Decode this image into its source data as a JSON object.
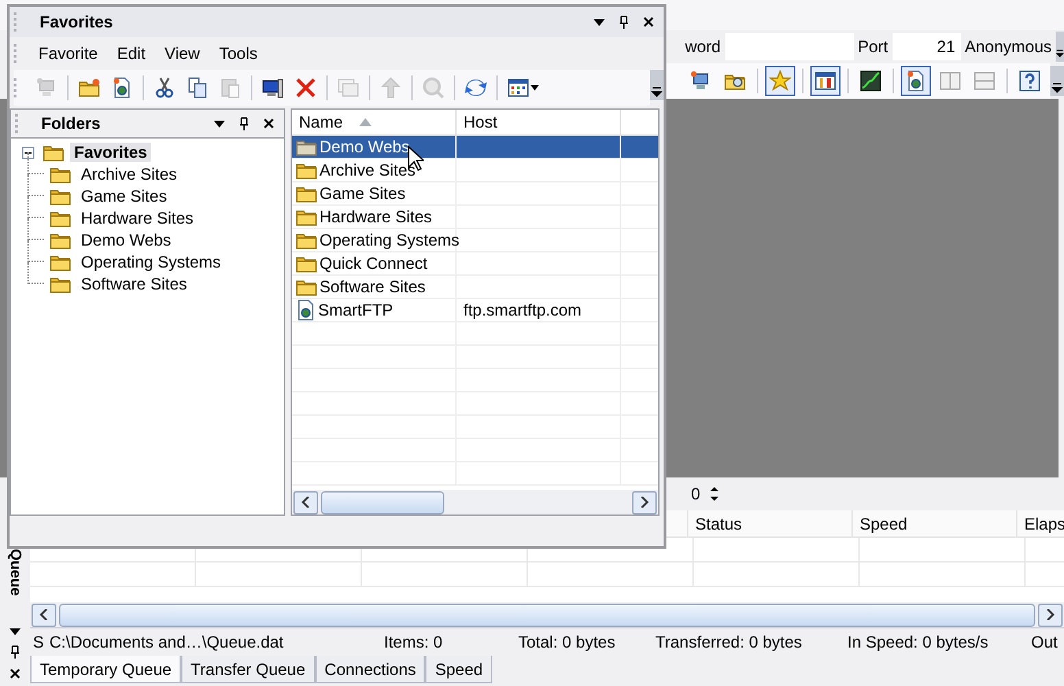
{
  "main": {
    "connect_bar": {
      "password_label": "word",
      "port_label": "Port",
      "port": "21",
      "anonymous_label": "Anonymous"
    },
    "toolbar": [
      [
        {
          "kind": "computer",
          "pressed": false
        },
        {
          "kind": "folder-search",
          "pressed": false
        }
      ],
      [
        {
          "kind": "star",
          "pressed": true
        }
      ],
      [
        {
          "kind": "tools",
          "pressed": true
        }
      ],
      [
        {
          "kind": "graph",
          "pressed": false
        }
      ],
      [
        {
          "kind": "page",
          "pressed": true
        },
        {
          "kind": "split-v",
          "pressed": false
        },
        {
          "kind": "split-h",
          "pressed": false
        }
      ],
      [
        {
          "kind": "help",
          "pressed": false
        }
      ]
    ],
    "spin_value": "0",
    "queue": {
      "side_label": "Queue",
      "columns": [
        "Status",
        "Speed",
        "Elaps"
      ],
      "status_bar": [
        "S",
        "C:\\Documents and…\\Queue.dat",
        "Items: 0",
        "Total: 0 bytes",
        "Transferred: 0 bytes",
        "In Speed: 0 bytes/s",
        "Out"
      ],
      "tabs": [
        {
          "label": "Temporary Queue",
          "selected": true
        },
        {
          "label": "Transfer Queue",
          "selected": false
        },
        {
          "label": "Connections",
          "selected": false
        },
        {
          "label": "Speed",
          "selected": false
        }
      ]
    }
  },
  "favorites_window": {
    "title": "Favorites",
    "menu": [
      "Favorite",
      "Edit",
      "View",
      "Tools"
    ],
    "toolbar": [
      [
        {
          "kind": "computer",
          "disabled": true
        }
      ],
      [
        {
          "kind": "new-folder",
          "disabled": false
        },
        {
          "kind": "page",
          "disabled": false
        }
      ],
      [
        {
          "kind": "cut",
          "disabled": false
        },
        {
          "kind": "copy",
          "disabled": false
        },
        {
          "kind": "paste",
          "disabled": true
        }
      ],
      [
        {
          "kind": "monitor",
          "disabled": false
        },
        {
          "kind": "delete",
          "disabled": false
        }
      ],
      [
        {
          "kind": "windows",
          "disabled": true
        }
      ],
      [
        {
          "kind": "up",
          "disabled": true
        }
      ],
      [
        {
          "kind": "search",
          "disabled": true
        }
      ],
      [
        {
          "kind": "refresh",
          "disabled": false
        }
      ],
      [
        {
          "kind": "view",
          "disabled": false
        }
      ]
    ],
    "folders": {
      "title": "Folders",
      "tree": [
        {
          "label": "Favorites",
          "expanded": true,
          "selected": true,
          "children": [
            {
              "label": "Archive Sites",
              "selected": false
            },
            {
              "label": "Game Sites",
              "selected": false
            },
            {
              "label": "Hardware Sites",
              "selected": false
            },
            {
              "label": "Demo Webs",
              "selected": false
            },
            {
              "label": "Operating Systems",
              "selected": false
            },
            {
              "label": "Software Sites",
              "selected": false
            }
          ]
        }
      ]
    },
    "list": {
      "columns": [
        {
          "label": "Name",
          "sorted": true
        },
        {
          "label": "Host",
          "sorted": false
        }
      ],
      "rows": [
        {
          "kind": "folder",
          "name": "Demo Webs",
          "selected": true
        },
        {
          "kind": "folder",
          "name": "Archive Sites",
          "selected": false
        },
        {
          "kind": "folder",
          "name": "Game Sites",
          "selected": false
        },
        {
          "kind": "folder",
          "name": "Hardware Sites",
          "selected": false
        },
        {
          "kind": "folder",
          "name": "Operating Systems",
          "selected": false
        },
        {
          "kind": "folder",
          "name": "Quick Connect",
          "selected": false
        },
        {
          "kind": "folder",
          "name": "Software Sites",
          "selected": false
        },
        {
          "kind": "site",
          "name": "SmartFTP",
          "host": "ftp.smartftp.com",
          "selected": false
        }
      ]
    }
  }
}
